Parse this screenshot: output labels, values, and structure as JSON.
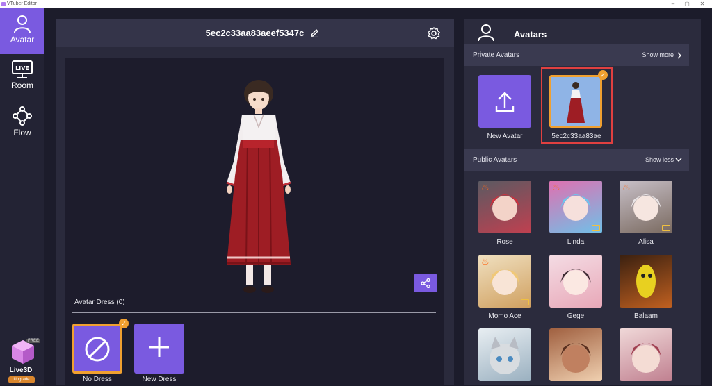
{
  "window": {
    "title": "VTuber Editor",
    "controls": [
      "–",
      "▢",
      "✕"
    ]
  },
  "sidebar": {
    "items": [
      {
        "label": "Avatar",
        "icon": "user-icon",
        "active": true
      },
      {
        "label": "Room",
        "icon": "live-monitor-icon",
        "active": false
      },
      {
        "label": "Flow",
        "icon": "flow-nodes-icon",
        "active": false
      }
    ],
    "brand": {
      "name": "Live3D",
      "badge": "FREE",
      "upgrade": "Upgrade"
    }
  },
  "editor": {
    "title": "5ec2c33aa83aeef5347c",
    "dress_section": "Avatar Dress (0)",
    "dresses": [
      {
        "label": "No Dress",
        "selected": true
      },
      {
        "label": "New Dress",
        "selected": false
      }
    ]
  },
  "avatars_panel": {
    "title": "Avatars",
    "private": {
      "label": "Private Avatars",
      "toggle": "Show more",
      "new_label": "New Avatar",
      "item_label": "5ec2c33aa83ae"
    },
    "public": {
      "label": "Public Avatars",
      "toggle": "Show less",
      "items": [
        {
          "label": "Rose",
          "hot": true,
          "premium": false
        },
        {
          "label": "Linda",
          "hot": true,
          "premium": true
        },
        {
          "label": "Alisa",
          "hot": true,
          "premium": true
        },
        {
          "label": "Momo Ace",
          "hot": true,
          "premium": true
        },
        {
          "label": "Gege",
          "hot": false,
          "premium": false
        },
        {
          "label": "Balaam",
          "hot": false,
          "premium": false
        },
        {
          "label": "",
          "hot": false,
          "premium": false
        },
        {
          "label": "",
          "hot": false,
          "premium": false
        },
        {
          "label": "",
          "hot": false,
          "premium": false
        }
      ]
    }
  },
  "colors": {
    "accent": "#7a5ae0",
    "selected": "#f0a030",
    "highlight": "#e04040"
  }
}
